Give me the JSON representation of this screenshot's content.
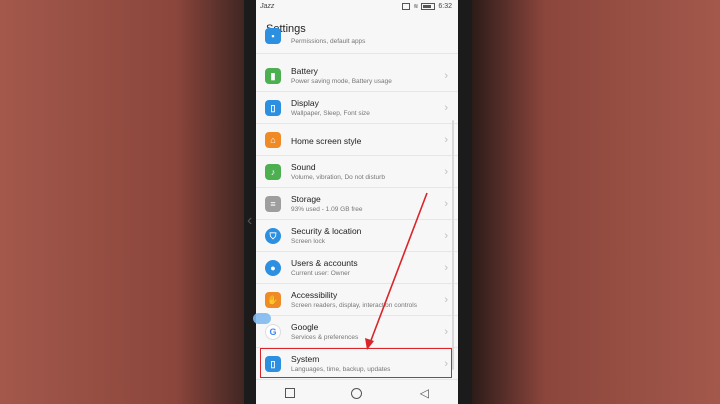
{
  "status_bar": {
    "carrier": "Jazz",
    "time": "6:32"
  },
  "header": {
    "title": "Settings"
  },
  "colors": {
    "red_annotation": "#d9252a",
    "battery_icon": "#4caf50",
    "display_icon": "#2c8fe0",
    "home_icon": "#f08a24",
    "sound_icon": "#4caf50",
    "storage_icon": "#9e9e9e",
    "security_icon": "#2c8fe0",
    "users_icon": "#2c8fe0",
    "accessibility_icon": "#f08a24",
    "google_icon": "#ffffff",
    "system_icon": "#2c8fe0"
  },
  "list": {
    "items": [
      {
        "label": "",
        "sub": "Permissions, default apps",
        "icon": "apps-icon"
      },
      {
        "label": "Battery",
        "sub": "Power saving mode, Battery usage",
        "icon": "battery-icon"
      },
      {
        "label": "Display",
        "sub": "Wallpaper, Sleep, Font size",
        "icon": "display-icon"
      },
      {
        "label": "Home screen style",
        "sub": "",
        "icon": "home-icon"
      },
      {
        "label": "Sound",
        "sub": "Volume, vibration, Do not disturb",
        "icon": "speaker-icon"
      },
      {
        "label": "Storage",
        "sub": "93% used - 1.09 GB free",
        "icon": "storage-icon"
      },
      {
        "label": "Security & location",
        "sub": "Screen lock",
        "icon": "shield-icon"
      },
      {
        "label": "Users & accounts",
        "sub": "Current user: Owner",
        "icon": "user-icon"
      },
      {
        "label": "Accessibility",
        "sub": "Screen readers, display, interaction controls",
        "icon": "hand-icon"
      },
      {
        "label": "Google",
        "sub": "Services & preferences",
        "icon": "google-icon"
      },
      {
        "label": "System",
        "sub": "Languages, time, backup, updates",
        "icon": "phone-icon"
      }
    ]
  }
}
